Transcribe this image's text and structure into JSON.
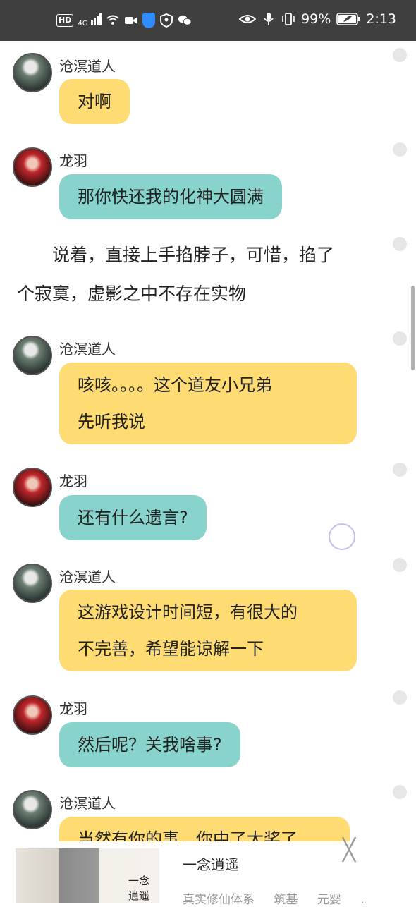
{
  "status_bar": {
    "left_icons": [
      "hd-icon",
      "signal-4g-icon",
      "wifi-icon",
      "video-icon",
      "shield-icon",
      "privacy-icon",
      "wechat-icon"
    ],
    "hd_label": "HD",
    "net_label": "4G",
    "battery": "99%",
    "time": "2:13",
    "right_icons": [
      "eye-icon",
      "mic-icon",
      "vibrate-icon",
      "battery-icon"
    ]
  },
  "messages": [
    {
      "type": "chat",
      "speaker": "沧溟道人",
      "avatar": "cang",
      "color": "yellow",
      "lines": [
        "对啊"
      ]
    },
    {
      "type": "chat",
      "speaker": "龙羽",
      "avatar": "long",
      "color": "teal",
      "lines": [
        "那你快还我的化神大圆满"
      ]
    },
    {
      "type": "narration",
      "lines": [
        "　　说着，直接上手掐脖子，可惜，掐了",
        "个寂寞，虚影之中不存在实物"
      ]
    },
    {
      "type": "chat",
      "speaker": "沧溟道人",
      "avatar": "cang",
      "color": "yellow",
      "lines": [
        "咳咳。。。。这个道友小兄弟",
        "先听我说"
      ]
    },
    {
      "type": "chat",
      "speaker": "龙羽",
      "avatar": "long",
      "color": "teal",
      "lines": [
        "还有什么遗言?"
      ]
    },
    {
      "type": "chat",
      "speaker": "沧溟道人",
      "avatar": "cang",
      "color": "yellow",
      "lines": [
        "这游戏设计时间短，有很大的",
        "不完善，希望能谅解一下"
      ]
    },
    {
      "type": "chat",
      "speaker": "龙羽",
      "avatar": "long",
      "color": "teal",
      "lines": [
        "然后呢？关我啥事?"
      ]
    },
    {
      "type": "chat",
      "speaker": "沧溟道人",
      "avatar": "cang",
      "color": "yellow",
      "lines": [
        "当然有你的事，你中了大奖了"
      ]
    }
  ],
  "ad": {
    "title": "一念逍遥",
    "logo_text": "一念逍遥",
    "tags": [
      "真实修仙体系",
      "筑基",
      "元婴",
      "..."
    ],
    "close_symbol": "╳"
  },
  "colors": {
    "yellow_bubble": "#fedb73",
    "teal_bubble": "#88d4cd",
    "status_bar": "#3f3f3f"
  }
}
